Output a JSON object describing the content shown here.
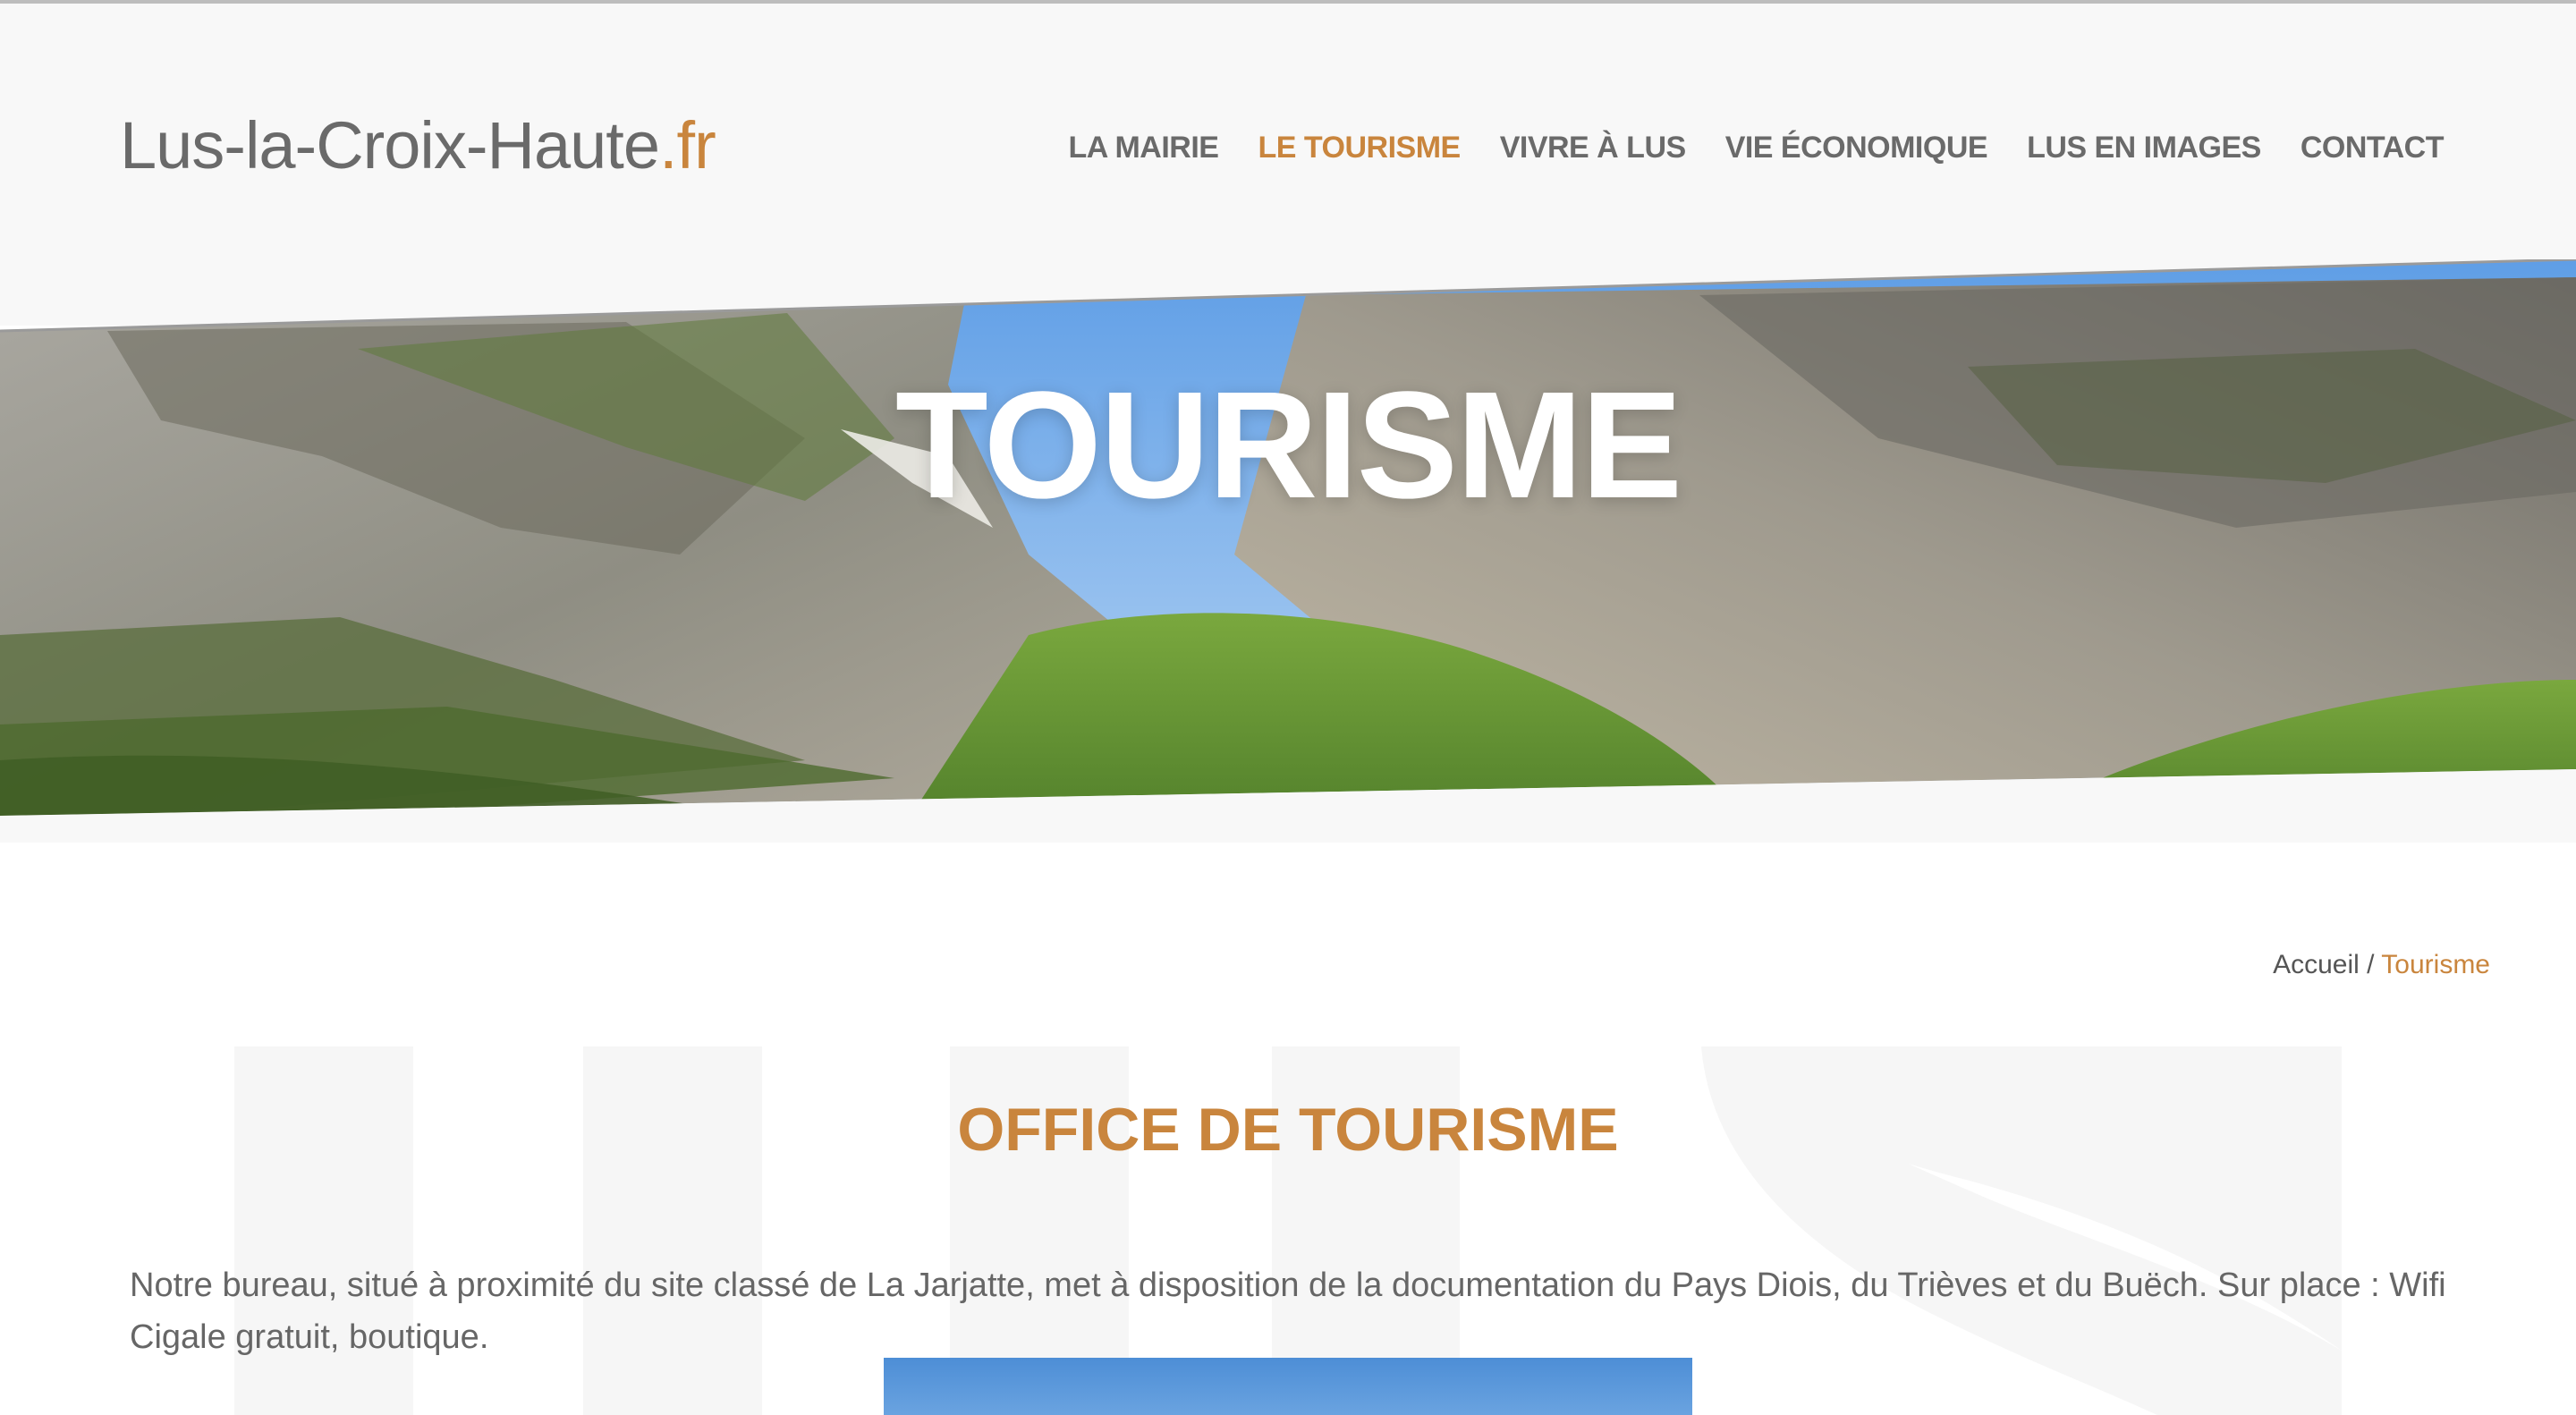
{
  "site": {
    "logo_main": "Lus-la-Croix-Haute",
    "logo_tld": ".fr"
  },
  "nav": {
    "items": [
      {
        "label": "LA MAIRIE",
        "active": false
      },
      {
        "label": "LE TOURISME",
        "active": true
      },
      {
        "label": "VIVRE À LUS",
        "active": false
      },
      {
        "label": "VIE ÉCONOMIQUE",
        "active": false
      },
      {
        "label": "LUS EN IMAGES",
        "active": false
      },
      {
        "label": "CONTACT",
        "active": false
      }
    ]
  },
  "hero": {
    "title": "TOURISME"
  },
  "breadcrumb": {
    "home": "Accueil",
    "separator": " / ",
    "current": "Tourisme"
  },
  "content": {
    "section_title": "OFFICE DE TOURISME",
    "paragraph": "Notre bureau, situé à proximité du site classé de La Jarjatte, met à disposition de la documentation du Pays Diois, du Trièves et du Buëch. Sur place : Wifi Cigale gratuit, boutique."
  },
  "colors": {
    "accent": "#c9853d",
    "text": "#6a6a6a",
    "header_bg": "#f8f8f8"
  }
}
